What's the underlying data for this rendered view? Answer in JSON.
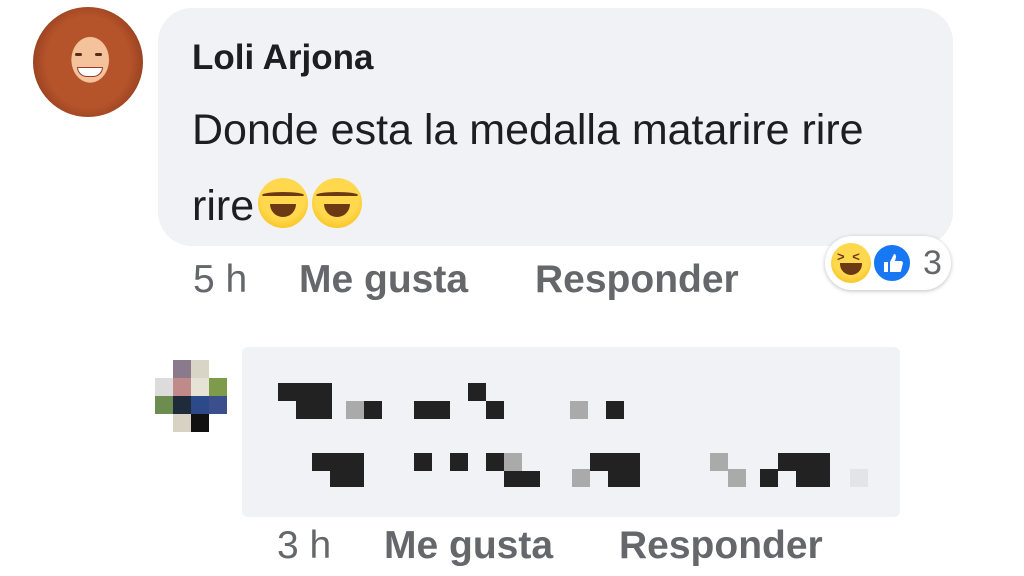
{
  "comment1": {
    "author": "Loli Arjona",
    "text": "Donde esta la medalla matarire rire rire",
    "emojis": [
      "joy-emoji",
      "joy-emoji"
    ],
    "time": "5 h",
    "like_label": "Me gusta",
    "reply_label": "Responder",
    "reactions": {
      "icons": [
        "haha-reaction-icon",
        "like-reaction-icon"
      ],
      "count": "3"
    }
  },
  "comment2": {
    "time": "3 h",
    "like_label": "Me gusta",
    "reply_label": "Responder"
  },
  "colors": {
    "bubble": "#f0f2f5",
    "meta_text": "#65676b",
    "like_blue": "#1877f2"
  }
}
